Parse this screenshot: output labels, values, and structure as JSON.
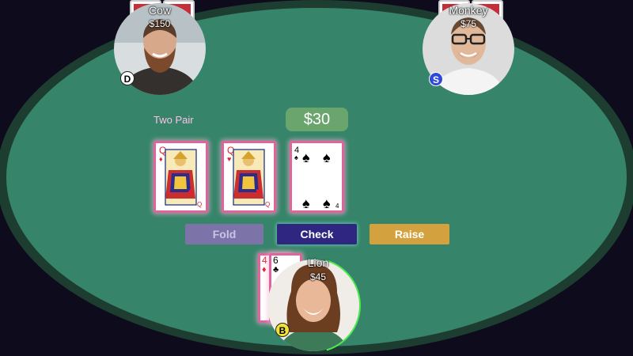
{
  "players": {
    "cow": {
      "name": "Cow",
      "stack": "$150",
      "badge": "D"
    },
    "monkey": {
      "name": "Monkey",
      "stack": "$75",
      "badge": "S"
    },
    "lion": {
      "name": "Lion",
      "stack": "$45",
      "badge": "B"
    }
  },
  "board": {
    "hand_label": "Two Pair",
    "pot": "$30",
    "cards": [
      {
        "rank": "Q",
        "suit": "♦",
        "color": "#e0202e"
      },
      {
        "rank": "Q",
        "suit": "♥",
        "color": "#e0202e"
      },
      {
        "rank": "4",
        "suit": "♠",
        "color": "#000000"
      }
    ]
  },
  "hero_cards": [
    {
      "rank": "4",
      "suit": "♦",
      "color": "#e0202e"
    },
    {
      "rank": "6",
      "suit": "♣",
      "color": "#000000"
    }
  ],
  "actions": {
    "fold": "Fold",
    "check": "Check",
    "raise": "Raise"
  },
  "colors": {
    "felt": "#36856a",
    "rail": "#1d3d31",
    "fold_bg": "#7c73a8",
    "check_bg": "#2e2680",
    "raise_bg": "#d3a23f",
    "timer_ring": "#4be84b",
    "card_highlight": "#e0649c"
  }
}
